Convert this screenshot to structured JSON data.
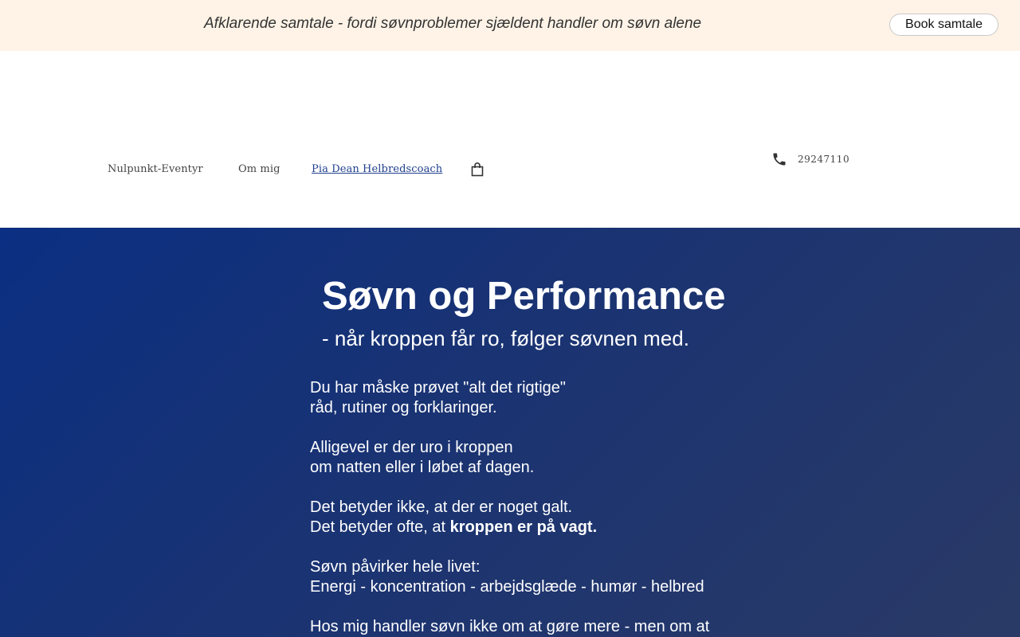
{
  "announcement": {
    "text": "Afklarende samtale - fordi søvnproblemer sjældent handler om søvn alene",
    "button_label": "Book samtale"
  },
  "nav": {
    "items": [
      {
        "label": "Nulpunkt-Eventyr",
        "active": false
      },
      {
        "label": "Om mig",
        "active": false
      },
      {
        "label": "Pia Dean Helbredscoach",
        "active": true
      }
    ],
    "cart_icon": "shopping-bag-icon"
  },
  "contact": {
    "phone_icon": "phone-icon",
    "phone": "29247110"
  },
  "hero": {
    "title": "Søvn og Performance",
    "subtitle": "- når kroppen får ro, følger søvnen med.",
    "lines": {
      "p1_l1": "Du har måske prøvet \"alt det rigtige\"",
      "p1_l2": "råd, rutiner og forklaringer.",
      "p2_l1": "Alligevel er der uro i kroppen",
      "p2_l2": "om natten eller i løbet af dagen.",
      "p3_l1": "Det betyder ikke, at der er noget galt.",
      "p3_l2_prefix": "Det betyder ofte, at ",
      "p3_l2_bold": "kroppen er på vagt.",
      "p4_l1": "Søvn påvirker hele livet:",
      "p4_l2": "Energi - koncentration - arbejdsglæde - humør  - helbred",
      "p5_l1": "Hos mig handler søvn ikke om at gøre mere - men om at"
    }
  },
  "colors": {
    "announcement_bg": "#fef3e6",
    "hero_gradient_start": "#0b2f82",
    "hero_gradient_end": "#2a3a66",
    "active_link": "#1f3f8c"
  }
}
